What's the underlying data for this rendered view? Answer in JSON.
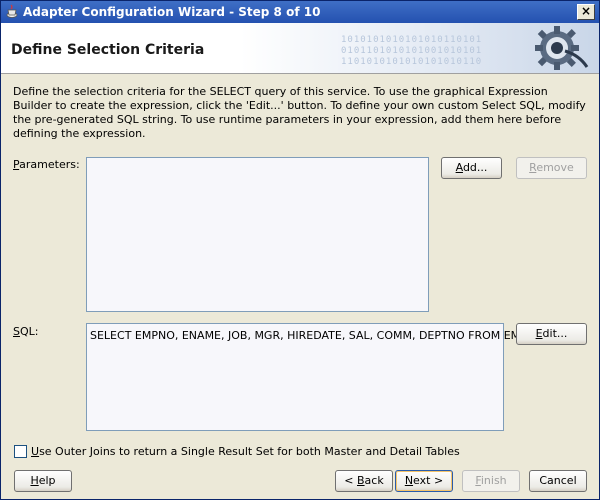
{
  "window": {
    "title": "Adapter Configuration Wizard - Step 8 of 10",
    "close_label": "×"
  },
  "header": {
    "title": "Define Selection Criteria",
    "binary": "1010101010101010110101\n0101101010101001010101\n1101010101010101010110"
  },
  "description": "Define the selection criteria for the SELECT query of this service.  To use the graphical Expression Builder to create the expression, click the 'Edit...' button.  To define your own custom Select SQL, modify the pre-generated SQL string.  To use runtime parameters in your expression, add them here before defining the expression.",
  "parameters": {
    "label_mnemonic": "P",
    "label_rest": "arameters:",
    "add_label_mnemonic": "A",
    "add_label_rest": "dd...",
    "remove_label_mnemonic": "R",
    "remove_label_rest": "emove"
  },
  "sql": {
    "label_mnemonic": "S",
    "label_rest": "QL:",
    "value": "SELECT EMPNO, ENAME, JOB, MGR, HIREDATE, SAL, COMM, DEPTNO FROM EMP",
    "edit_label_mnemonic": "E",
    "edit_label_rest": "dit..."
  },
  "outer_joins": {
    "label_mnemonic": "U",
    "label_rest": "se Outer Joins to return a Single Result Set for both Master and Detail Tables",
    "checked": false
  },
  "footer": {
    "help_mnemonic": "H",
    "help_rest": "elp",
    "back_prefix": "< ",
    "back_mnemonic": "B",
    "back_rest": "ack",
    "next_mnemonic": "N",
    "next_rest": "ext >",
    "finish_mnemonic": "F",
    "finish_rest": "inish",
    "cancel_label": "Cancel"
  }
}
